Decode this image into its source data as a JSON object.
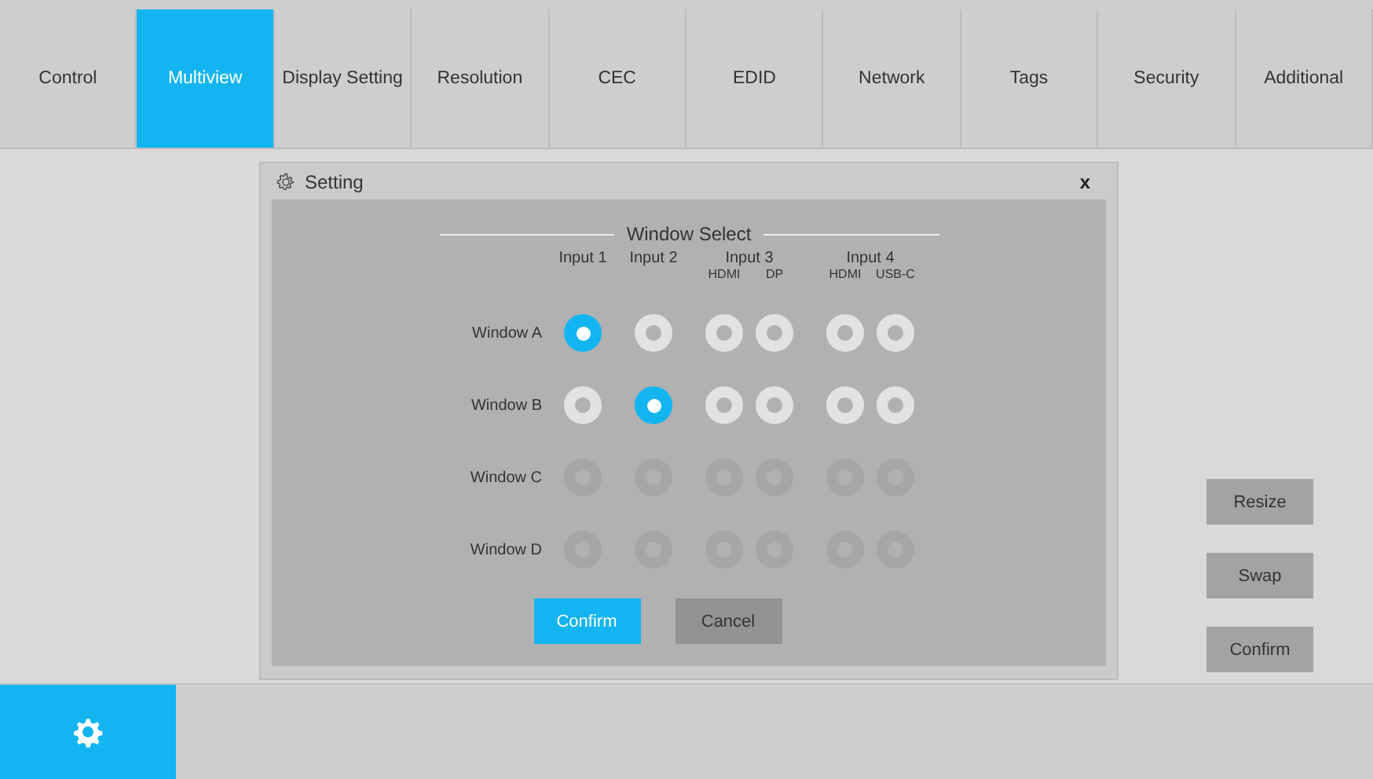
{
  "tabs": [
    {
      "label": "Control",
      "selected": false
    },
    {
      "label": "Multiview",
      "selected": true
    },
    {
      "label": "Display Setting",
      "selected": false
    },
    {
      "label": "Resolution",
      "selected": false
    },
    {
      "label": "CEC",
      "selected": false
    },
    {
      "label": "EDID",
      "selected": false
    },
    {
      "label": "Network",
      "selected": false
    },
    {
      "label": "Tags",
      "selected": false
    },
    {
      "label": "Security",
      "selected": false
    },
    {
      "label": "Additional",
      "selected": false
    }
  ],
  "dialog": {
    "title": "Setting",
    "close": "x",
    "section_title": "Window Select",
    "inputs": [
      {
        "label": "Input 1"
      },
      {
        "label": "Input 2"
      },
      {
        "label": "Input 3",
        "subs": [
          "HDMI",
          "DP"
        ]
      },
      {
        "label": "Input 4",
        "subs": [
          "HDMI",
          "USB-C"
        ]
      }
    ],
    "rows": [
      {
        "label": "Window A",
        "disabled": false,
        "options": [
          {
            "selected": true
          },
          {
            "selected": false
          },
          {
            "selected": false
          },
          {
            "selected": false
          },
          {
            "selected": false
          },
          {
            "selected": false
          }
        ]
      },
      {
        "label": "Window B",
        "disabled": false,
        "options": [
          {
            "selected": false
          },
          {
            "selected": true
          },
          {
            "selected": false
          },
          {
            "selected": false
          },
          {
            "selected": false
          },
          {
            "selected": false
          }
        ]
      },
      {
        "label": "Window C",
        "disabled": true,
        "options": [
          {
            "selected": false
          },
          {
            "selected": false
          },
          {
            "selected": false
          },
          {
            "selected": false
          },
          {
            "selected": false
          },
          {
            "selected": false
          }
        ]
      },
      {
        "label": "Window D",
        "disabled": true,
        "options": [
          {
            "selected": false
          },
          {
            "selected": false
          },
          {
            "selected": false
          },
          {
            "selected": false
          },
          {
            "selected": false
          },
          {
            "selected": false
          }
        ]
      }
    ],
    "buttons": [
      {
        "label": "Confirm",
        "kind": "primary"
      },
      {
        "label": "Cancel",
        "kind": "secondary"
      }
    ]
  },
  "side_buttons": [
    "Resize",
    "Swap",
    "Confirm"
  ]
}
